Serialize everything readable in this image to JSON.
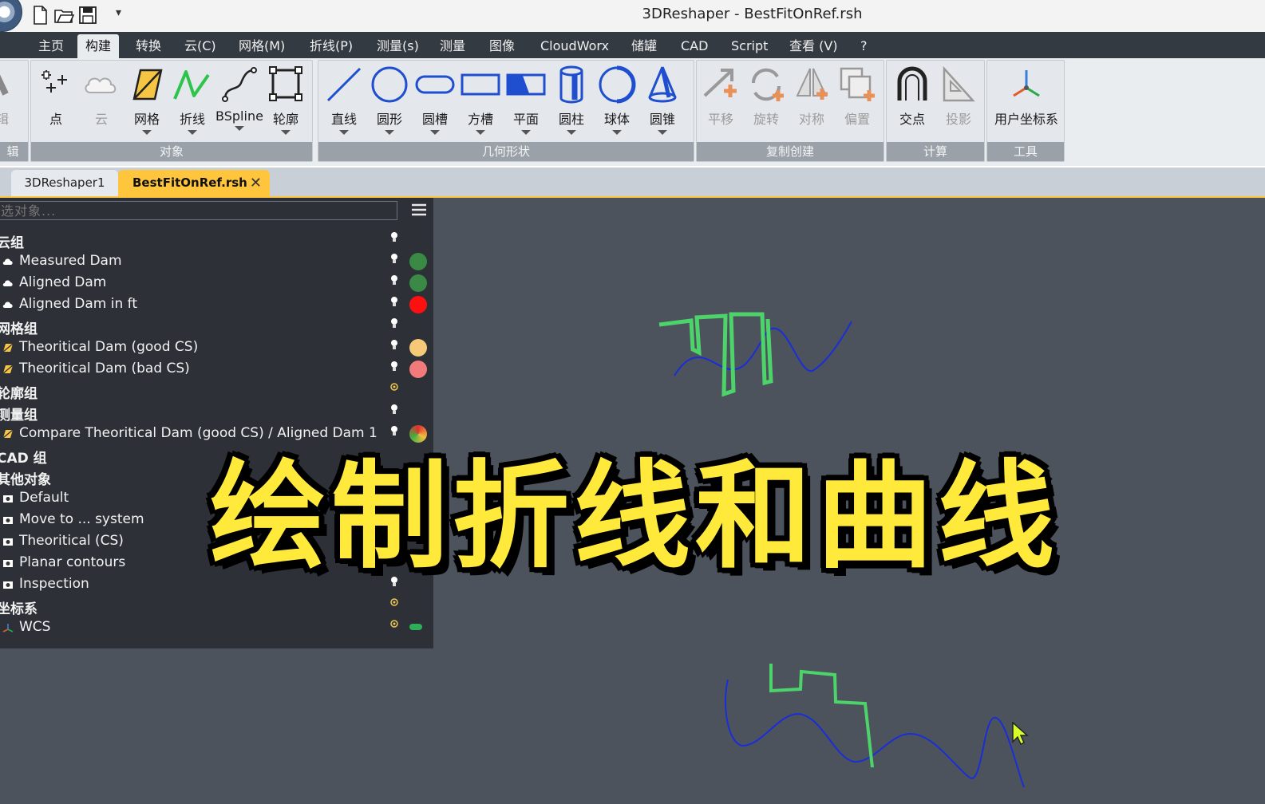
{
  "window_title": "3DReshaper - BestFitOnRef.rsh",
  "quick_access": {
    "more": "▾"
  },
  "menu": [
    "主页",
    "构建",
    "转换",
    "云(C)",
    "网格(M)",
    "折线(P)",
    "测量(s)",
    "测量",
    "图像",
    "CloudWorx",
    "储罐",
    "CAD",
    "Script",
    "查看 (V)",
    "?"
  ],
  "active_menu_index": 1,
  "ribbon": {
    "groups": [
      {
        "label": "辑"
      },
      {
        "label": "对象"
      },
      {
        "label": "几何形状"
      },
      {
        "label": "复制创建"
      },
      {
        "label": "计算"
      },
      {
        "label": "工具"
      }
    ],
    "tools": {
      "edit": "辑",
      "point": "点",
      "cloud": "云",
      "mesh": "网格",
      "polyline": "折线",
      "bspline": "BSpline",
      "contour": "轮廓",
      "line": "直线",
      "circle": "圆形",
      "slot": "圆槽",
      "rect_slot": "方槽",
      "plane": "平面",
      "cylinder": "圆柱",
      "sphere": "球体",
      "cone": "圆锥",
      "translate": "平移",
      "rotate": "旋转",
      "symmetry": "对称",
      "offset": "偏置",
      "intersection": "交点",
      "projection": "投影",
      "ucs": "用户坐标系"
    }
  },
  "tabs": {
    "tab1": "3DReshaper1",
    "tab2": "BestFitOnRef.rsh",
    "close": "✕"
  },
  "tree": {
    "filter_placeholder": "选对象...",
    "rows": [
      {
        "text": "云组",
        "header": true
      },
      {
        "text": "Measured Dam",
        "dot": "#3a8a45",
        "icon": "cloud"
      },
      {
        "text": "Aligned Dam",
        "dot": "#3a8a45",
        "icon": "cloud"
      },
      {
        "text": "Aligned Dam in ft",
        "dot": "#ff1010",
        "icon": "cloud"
      },
      {
        "text": "网格组",
        "header": true
      },
      {
        "text": "Theoritical Dam (good CS)",
        "dot": "#f6c979",
        "icon": "mesh"
      },
      {
        "text": "Theoritical Dam (bad CS)",
        "dot": "#f27a7a",
        "icon": "mesh"
      },
      {
        "text": "轮廓组",
        "header": true
      },
      {
        "text": "测量组",
        "header": true
      },
      {
        "text": "Compare Theoritical Dam (good CS) / Aligned Dam 1",
        "dot": "#e08a2a",
        "icon": "mesh"
      },
      {
        "text": "CAD 组",
        "header": true
      },
      {
        "text": "其他对象",
        "header": true
      },
      {
        "text": "Default",
        "icon": "cam"
      },
      {
        "text": "Move to ... system",
        "icon": "cam"
      },
      {
        "text": "Theoritical (CS)",
        "icon": "cam"
      },
      {
        "text": "Planar contours",
        "icon": "cam"
      },
      {
        "text": "Inspection",
        "icon": "cam"
      },
      {
        "text": "坐标系",
        "header": true
      },
      {
        "text": "WCS",
        "icon": "axes"
      }
    ]
  },
  "caption": "绘制折线和曲线",
  "colors": {
    "polyline": "#4cd46a",
    "curve": "#1a2ed8",
    "accent": "#ffc53d",
    "caption": "#ffe93a"
  }
}
